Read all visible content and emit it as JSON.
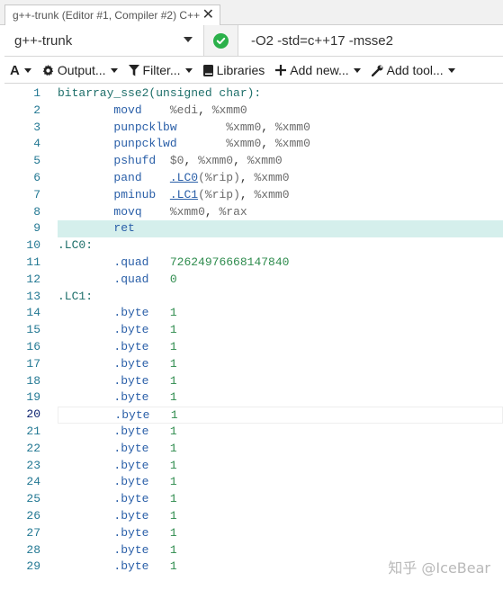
{
  "tab": {
    "title": "g++-trunk (Editor #1, Compiler #2) C++",
    "close_glyph": "✕"
  },
  "compiler": {
    "name": "g++-trunk",
    "options": "-O2 -std=c++17 -msse2",
    "status": "ok"
  },
  "toolbar": {
    "font_label": "A",
    "output_label": "Output...",
    "filter_label": "Filter...",
    "libraries_label": "Libraries",
    "add_new_label": "Add new...",
    "add_tool_label": "Add tool..."
  },
  "editor": {
    "highlighted_line": 9,
    "current_line": 20,
    "lines": [
      {
        "n": "1",
        "parts": [
          {
            "t": "label",
            "v": "bitarray_sse2(unsigned char):"
          }
        ]
      },
      {
        "n": "2",
        "parts": [
          {
            "t": "plain",
            "v": "        "
          },
          {
            "t": "instr",
            "v": "movd"
          },
          {
            "t": "plain",
            "v": "    "
          },
          {
            "t": "reg",
            "v": "%edi"
          },
          {
            "t": "plain",
            "v": ", "
          },
          {
            "t": "reg",
            "v": "%xmm0"
          }
        ]
      },
      {
        "n": "3",
        "parts": [
          {
            "t": "plain",
            "v": "        "
          },
          {
            "t": "instr",
            "v": "punpcklbw"
          },
          {
            "t": "plain",
            "v": "       "
          },
          {
            "t": "reg",
            "v": "%xmm0"
          },
          {
            "t": "plain",
            "v": ", "
          },
          {
            "t": "reg",
            "v": "%xmm0"
          }
        ]
      },
      {
        "n": "4",
        "parts": [
          {
            "t": "plain",
            "v": "        "
          },
          {
            "t": "instr",
            "v": "punpcklwd"
          },
          {
            "t": "plain",
            "v": "       "
          },
          {
            "t": "reg",
            "v": "%xmm0"
          },
          {
            "t": "plain",
            "v": ", "
          },
          {
            "t": "reg",
            "v": "%xmm0"
          }
        ]
      },
      {
        "n": "5",
        "parts": [
          {
            "t": "plain",
            "v": "        "
          },
          {
            "t": "instr",
            "v": "pshufd"
          },
          {
            "t": "plain",
            "v": "  "
          },
          {
            "t": "reg",
            "v": "$0"
          },
          {
            "t": "plain",
            "v": ", "
          },
          {
            "t": "reg",
            "v": "%xmm0"
          },
          {
            "t": "plain",
            "v": ", "
          },
          {
            "t": "reg",
            "v": "%xmm0"
          }
        ]
      },
      {
        "n": "6",
        "parts": [
          {
            "t": "plain",
            "v": "        "
          },
          {
            "t": "instr",
            "v": "pand"
          },
          {
            "t": "plain",
            "v": "    "
          },
          {
            "t": "link",
            "v": ".LC0"
          },
          {
            "t": "reg",
            "v": "(%rip)"
          },
          {
            "t": "plain",
            "v": ", "
          },
          {
            "t": "reg",
            "v": "%xmm0"
          }
        ]
      },
      {
        "n": "7",
        "parts": [
          {
            "t": "plain",
            "v": "        "
          },
          {
            "t": "instr",
            "v": "pminub"
          },
          {
            "t": "plain",
            "v": "  "
          },
          {
            "t": "link",
            "v": ".LC1"
          },
          {
            "t": "reg",
            "v": "(%rip)"
          },
          {
            "t": "plain",
            "v": ", "
          },
          {
            "t": "reg",
            "v": "%xmm0"
          }
        ]
      },
      {
        "n": "8",
        "parts": [
          {
            "t": "plain",
            "v": "        "
          },
          {
            "t": "instr",
            "v": "movq"
          },
          {
            "t": "plain",
            "v": "    "
          },
          {
            "t": "reg",
            "v": "%xmm0"
          },
          {
            "t": "plain",
            "v": ", "
          },
          {
            "t": "reg",
            "v": "%rax"
          }
        ]
      },
      {
        "n": "9",
        "parts": [
          {
            "t": "plain",
            "v": "        "
          },
          {
            "t": "ret",
            "v": "ret"
          }
        ]
      },
      {
        "n": "10",
        "parts": [
          {
            "t": "label",
            "v": ".LC0:"
          }
        ]
      },
      {
        "n": "11",
        "parts": [
          {
            "t": "plain",
            "v": "        "
          },
          {
            "t": "directive",
            "v": ".quad"
          },
          {
            "t": "plain",
            "v": "   "
          },
          {
            "t": "num",
            "v": "72624976668147840"
          }
        ]
      },
      {
        "n": "12",
        "parts": [
          {
            "t": "plain",
            "v": "        "
          },
          {
            "t": "directive",
            "v": ".quad"
          },
          {
            "t": "plain",
            "v": "   "
          },
          {
            "t": "num",
            "v": "0"
          }
        ]
      },
      {
        "n": "13",
        "parts": [
          {
            "t": "label",
            "v": ".LC1:"
          }
        ]
      },
      {
        "n": "14",
        "parts": [
          {
            "t": "plain",
            "v": "        "
          },
          {
            "t": "directive",
            "v": ".byte"
          },
          {
            "t": "plain",
            "v": "   "
          },
          {
            "t": "num",
            "v": "1"
          }
        ]
      },
      {
        "n": "15",
        "parts": [
          {
            "t": "plain",
            "v": "        "
          },
          {
            "t": "directive",
            "v": ".byte"
          },
          {
            "t": "plain",
            "v": "   "
          },
          {
            "t": "num",
            "v": "1"
          }
        ]
      },
      {
        "n": "16",
        "parts": [
          {
            "t": "plain",
            "v": "        "
          },
          {
            "t": "directive",
            "v": ".byte"
          },
          {
            "t": "plain",
            "v": "   "
          },
          {
            "t": "num",
            "v": "1"
          }
        ]
      },
      {
        "n": "17",
        "parts": [
          {
            "t": "plain",
            "v": "        "
          },
          {
            "t": "directive",
            "v": ".byte"
          },
          {
            "t": "plain",
            "v": "   "
          },
          {
            "t": "num",
            "v": "1"
          }
        ]
      },
      {
        "n": "18",
        "parts": [
          {
            "t": "plain",
            "v": "        "
          },
          {
            "t": "directive",
            "v": ".byte"
          },
          {
            "t": "plain",
            "v": "   "
          },
          {
            "t": "num",
            "v": "1"
          }
        ]
      },
      {
        "n": "19",
        "parts": [
          {
            "t": "plain",
            "v": "        "
          },
          {
            "t": "directive",
            "v": ".byte"
          },
          {
            "t": "plain",
            "v": "   "
          },
          {
            "t": "num",
            "v": "1"
          }
        ]
      },
      {
        "n": "20",
        "parts": [
          {
            "t": "plain",
            "v": "        "
          },
          {
            "t": "directive",
            "v": ".byte"
          },
          {
            "t": "plain",
            "v": "   "
          },
          {
            "t": "num",
            "v": "1"
          }
        ]
      },
      {
        "n": "21",
        "parts": [
          {
            "t": "plain",
            "v": "        "
          },
          {
            "t": "directive",
            "v": ".byte"
          },
          {
            "t": "plain",
            "v": "   "
          },
          {
            "t": "num",
            "v": "1"
          }
        ]
      },
      {
        "n": "22",
        "parts": [
          {
            "t": "plain",
            "v": "        "
          },
          {
            "t": "directive",
            "v": ".byte"
          },
          {
            "t": "plain",
            "v": "   "
          },
          {
            "t": "num",
            "v": "1"
          }
        ]
      },
      {
        "n": "23",
        "parts": [
          {
            "t": "plain",
            "v": "        "
          },
          {
            "t": "directive",
            "v": ".byte"
          },
          {
            "t": "plain",
            "v": "   "
          },
          {
            "t": "num",
            "v": "1"
          }
        ]
      },
      {
        "n": "24",
        "parts": [
          {
            "t": "plain",
            "v": "        "
          },
          {
            "t": "directive",
            "v": ".byte"
          },
          {
            "t": "plain",
            "v": "   "
          },
          {
            "t": "num",
            "v": "1"
          }
        ]
      },
      {
        "n": "25",
        "parts": [
          {
            "t": "plain",
            "v": "        "
          },
          {
            "t": "directive",
            "v": ".byte"
          },
          {
            "t": "plain",
            "v": "   "
          },
          {
            "t": "num",
            "v": "1"
          }
        ]
      },
      {
        "n": "26",
        "parts": [
          {
            "t": "plain",
            "v": "        "
          },
          {
            "t": "directive",
            "v": ".byte"
          },
          {
            "t": "plain",
            "v": "   "
          },
          {
            "t": "num",
            "v": "1"
          }
        ]
      },
      {
        "n": "27",
        "parts": [
          {
            "t": "plain",
            "v": "        "
          },
          {
            "t": "directive",
            "v": ".byte"
          },
          {
            "t": "plain",
            "v": "   "
          },
          {
            "t": "num",
            "v": "1"
          }
        ]
      },
      {
        "n": "28",
        "parts": [
          {
            "t": "plain",
            "v": "        "
          },
          {
            "t": "directive",
            "v": ".byte"
          },
          {
            "t": "plain",
            "v": "   "
          },
          {
            "t": "num",
            "v": "1"
          }
        ]
      },
      {
        "n": "29",
        "parts": [
          {
            "t": "plain",
            "v": "        "
          },
          {
            "t": "directive",
            "v": ".byte"
          },
          {
            "t": "plain",
            "v": "   "
          },
          {
            "t": "num",
            "v": "1"
          }
        ]
      }
    ]
  },
  "watermark": {
    "text": "知乎 @IceBear"
  },
  "colors": {
    "highlight_line": "#d5efec",
    "status_ok": "#2bb04a",
    "line_number": "#237893"
  }
}
